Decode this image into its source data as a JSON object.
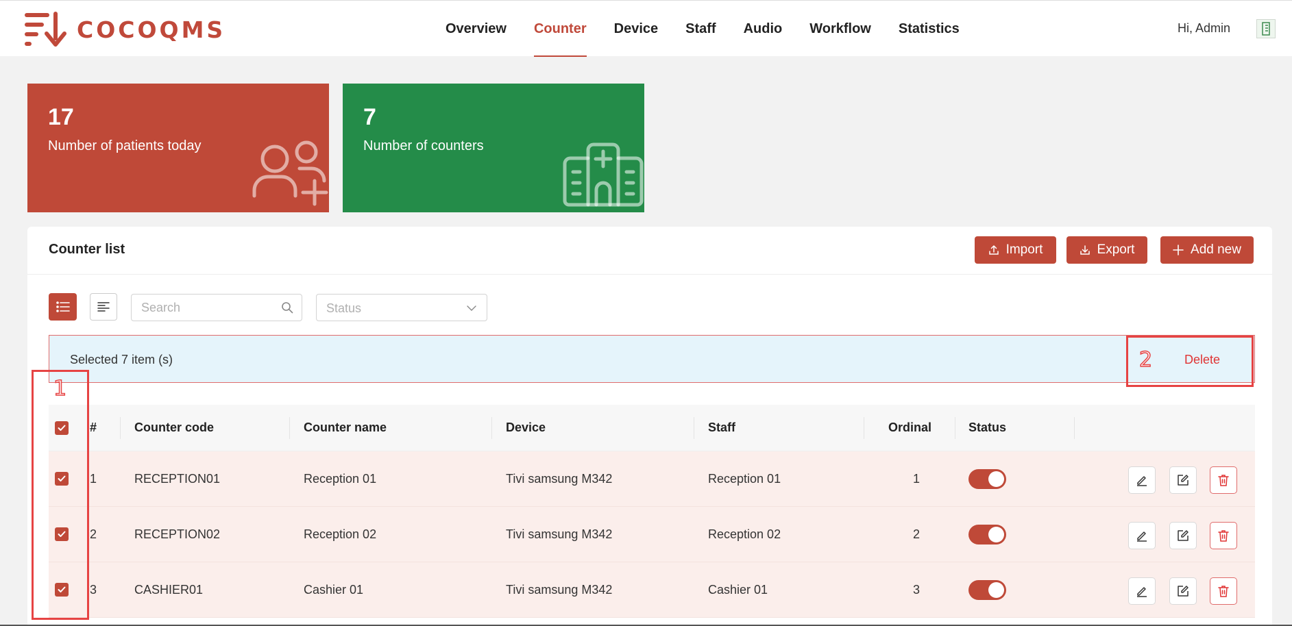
{
  "app": {
    "brand": "COCOQMS",
    "greeting": "Hi, Admin"
  },
  "nav": {
    "items": [
      {
        "label": "Overview"
      },
      {
        "label": "Counter",
        "active": true
      },
      {
        "label": "Device"
      },
      {
        "label": "Staff"
      },
      {
        "label": "Audio"
      },
      {
        "label": "Workflow"
      },
      {
        "label": "Statistics"
      }
    ]
  },
  "stats": {
    "patients": {
      "value": "17",
      "label": "Number of patients today",
      "color": "#bf4938",
      "icon": "users-plus-icon"
    },
    "counters": {
      "value": "7",
      "label": "Number of counters",
      "color": "#248c49",
      "icon": "hospital-icon"
    }
  },
  "panel": {
    "title": "Counter list",
    "buttons": {
      "import": "Import",
      "export": "Export",
      "add": "Add new"
    },
    "search_placeholder": "Search",
    "status_placeholder": "Status",
    "selection_text": "Selected 7 item (s)",
    "delete_label": "Delete"
  },
  "table": {
    "headers": [
      "#",
      "Counter code",
      "Counter name",
      "Device",
      "Staff",
      "Ordinal",
      "Status"
    ],
    "rows": [
      {
        "num": "1",
        "code": "RECEPTION01",
        "name": "Reception 01",
        "device": "Tivi samsung M342",
        "staff": "Reception 01",
        "ordinal": "1",
        "status": true
      },
      {
        "num": "2",
        "code": "RECEPTION02",
        "name": "Reception 02",
        "device": "Tivi samsung M342",
        "staff": "Reception 02",
        "ordinal": "2",
        "status": true
      },
      {
        "num": "3",
        "code": "CASHIER01",
        "name": "Cashier 01",
        "device": "Tivi samsung M342",
        "staff": "Cashier 01",
        "ordinal": "3",
        "status": true
      }
    ]
  },
  "annotations": {
    "one": "1",
    "two": "2"
  },
  "colors": {
    "accent": "#bf4938",
    "green": "#248c49",
    "selection_bg": "#e5f4fb",
    "row_bg": "#fbeeeb",
    "annotation": "#e64343"
  }
}
